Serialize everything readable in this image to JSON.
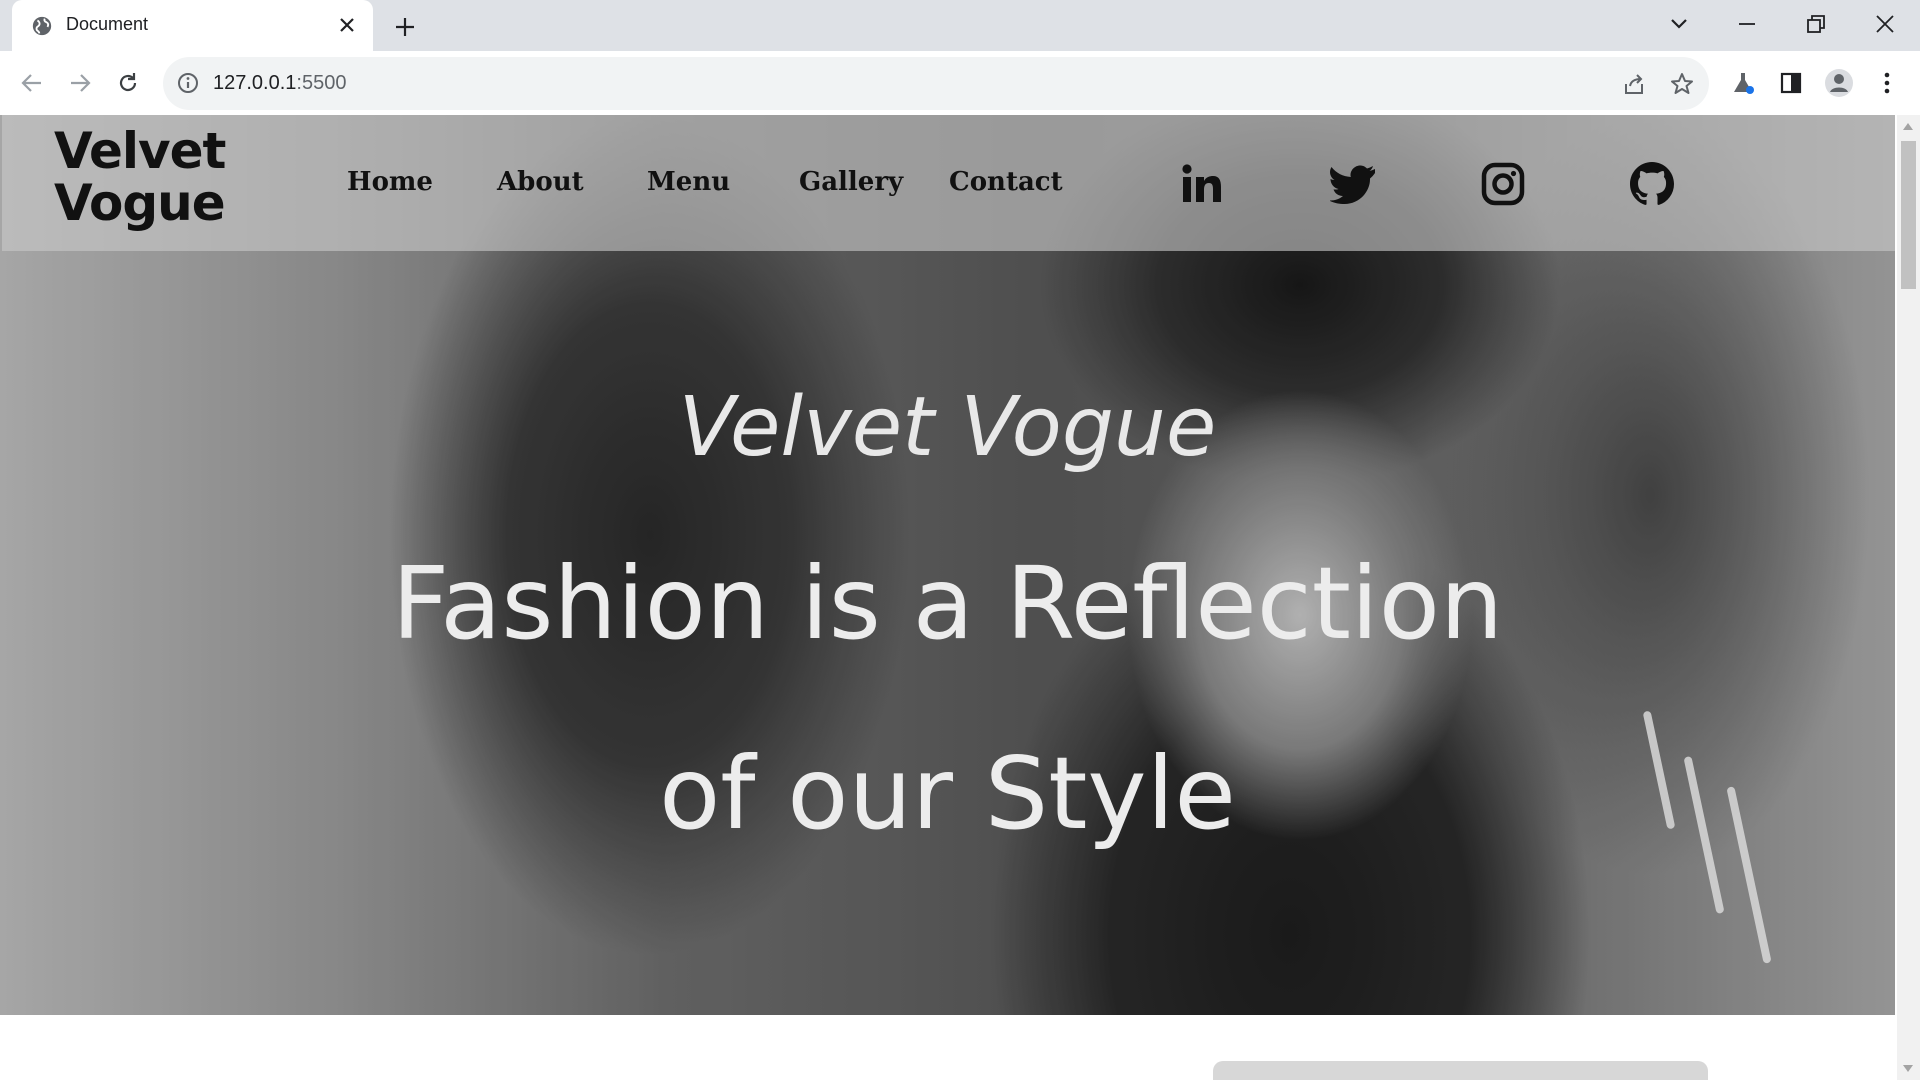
{
  "browser": {
    "tab_title": "Document",
    "url_host": "127.0.0.1",
    "url_port": ":5500"
  },
  "site": {
    "brand_line1": "Velvet",
    "brand_line2": "Vogue",
    "nav": [
      "Home",
      "About",
      "Menu",
      "Gallery",
      "Contact"
    ],
    "social": [
      "linkedin-icon",
      "twitter-icon",
      "instagram-icon",
      "github-icon"
    ]
  },
  "hero": {
    "kicker": "Velvet Vogue",
    "line1": "Fashion is a Reflection",
    "line2": "of our Style"
  },
  "colors": {
    "chrome_bg": "#dee1e6",
    "omnibox_bg": "#f1f3f4",
    "header_overlay": "#c8c8c8",
    "hero_text": "#ececec"
  }
}
